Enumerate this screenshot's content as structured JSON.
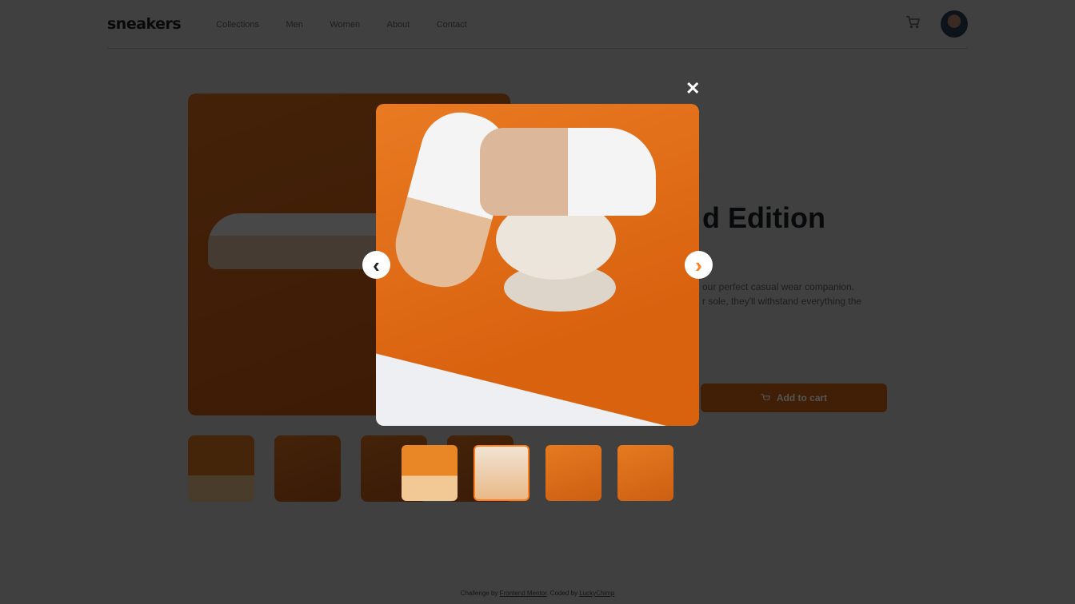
{
  "header": {
    "logo": "sneakers",
    "nav": [
      "Collections",
      "Men",
      "Women",
      "About",
      "Contact"
    ]
  },
  "product": {
    "title": "Fall Limited Edition Sneakers",
    "title_visible": "d Edition",
    "description_visible": [
      "our perfect casual wear companion.",
      "r sole, they'll withstand everything the"
    ],
    "add_to_cart": "Add to cart"
  },
  "footer": {
    "prefix": "Challenge by",
    "link1": "Frontend Mentor",
    "mid": ". Coded by",
    "link2": "LuckyChimp"
  },
  "lightbox": {
    "close": "✕",
    "prev": "‹",
    "next": "›",
    "active_index": 1,
    "thumb_count": 4
  },
  "colors": {
    "accent": "#ff7d1a",
    "text": "#1d2025"
  }
}
